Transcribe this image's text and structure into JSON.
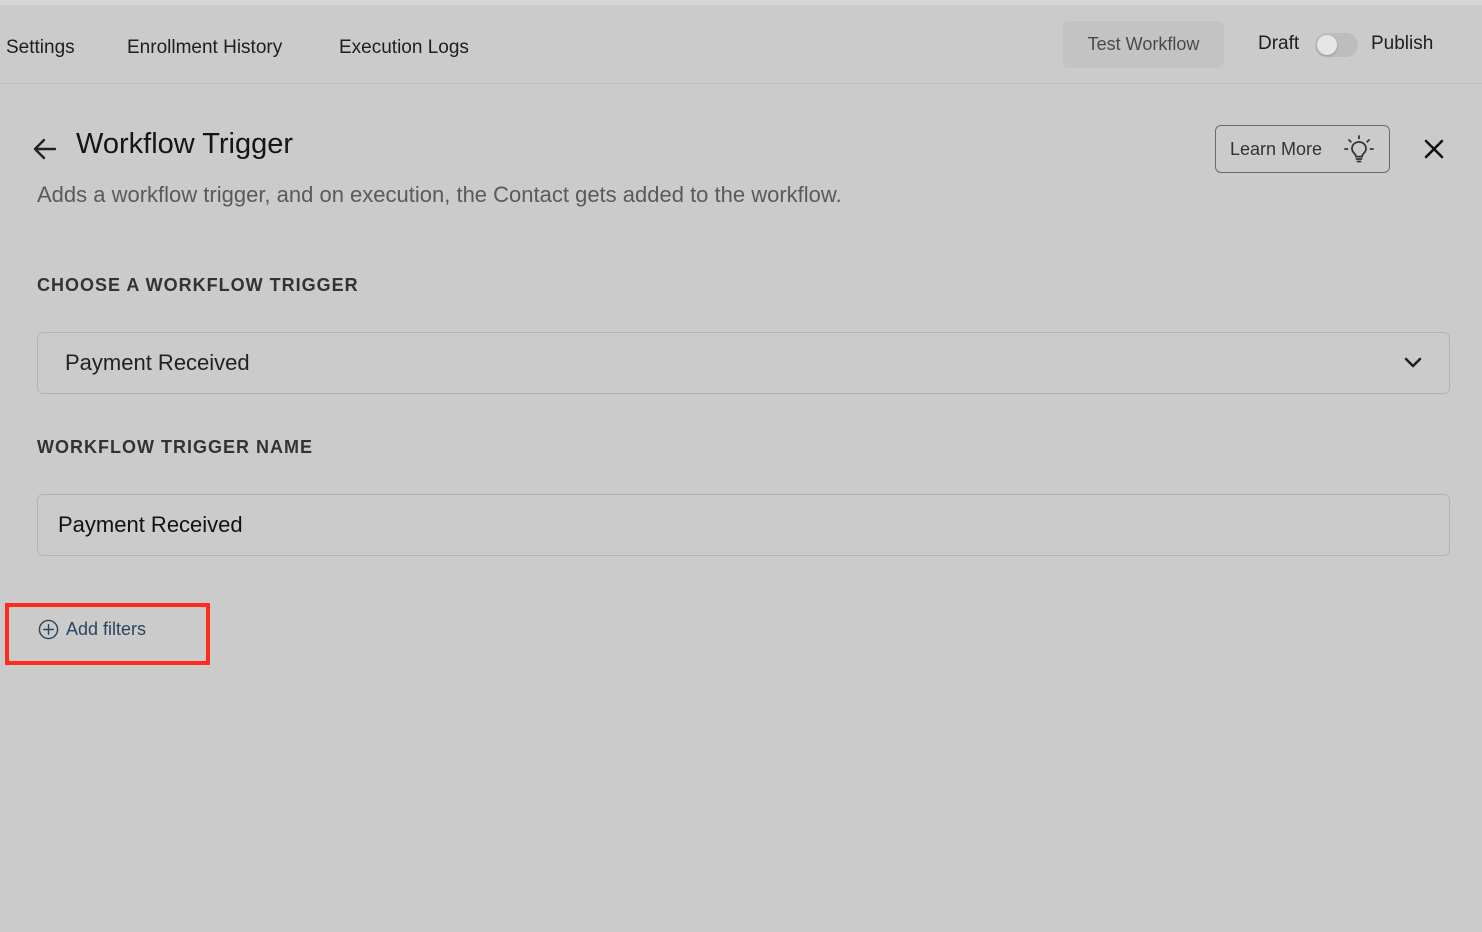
{
  "nav": {
    "tabs": [
      {
        "label": "Settings"
      },
      {
        "label": "Enrollment History"
      },
      {
        "label": "Execution Logs"
      }
    ],
    "test_workflow_label": "Test Workflow",
    "draft_label": "Draft",
    "publish_label": "Publish",
    "publish_toggle_on": false
  },
  "panel": {
    "title": "Workflow Trigger",
    "subtitle": "Adds a workflow trigger, and on execution, the Contact gets added to the workflow.",
    "learn_more_label": "Learn More",
    "icons": {
      "back": "arrow-left-icon",
      "close": "close-icon",
      "learn_more": "lightbulb-icon"
    }
  },
  "form": {
    "trigger_section_label": "CHOOSE A WORKFLOW TRIGGER",
    "trigger_selected": "Payment Received",
    "name_section_label": "WORKFLOW TRIGGER NAME",
    "name_value": "Payment Received"
  },
  "filters": {
    "add_label": "Add filters",
    "highlight_color": "#ff2a1a"
  },
  "colors": {
    "background": "#cbcbcb",
    "link": "#29465f"
  }
}
